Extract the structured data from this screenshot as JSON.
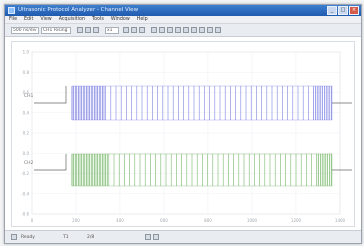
{
  "window": {
    "title": "Ultrasonic Protocol Analyzer - Channel View"
  },
  "menu": [
    "File",
    "Edit",
    "View",
    "Acquisition",
    "Tools",
    "Window",
    "Help"
  ],
  "toolbar": {
    "timebase_field": "500 ns/div",
    "trigger_field": "CH1 Rising",
    "zoom_label": "x1"
  },
  "plot": {
    "y_labels": [
      "1.0",
      "0.8",
      "0.6",
      "0.4",
      "0.2",
      "0.0",
      "-0.2",
      "-0.4",
      "-0.6"
    ],
    "x_labels": [
      "0",
      "200",
      "400",
      "600",
      "800",
      "1000",
      "1200",
      "1400"
    ],
    "tracks": [
      {
        "name": "CH1",
        "color": "#4a4fd8"
      },
      {
        "name": "CH2",
        "color": "#3f9a2e"
      }
    ]
  },
  "status": {
    "mode": "Ready",
    "cursor": "T1",
    "count": "2/8"
  }
}
